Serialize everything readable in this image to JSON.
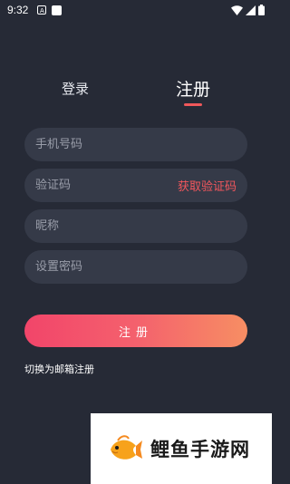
{
  "status_bar": {
    "time": "9:32",
    "notification_icon": "A"
  },
  "tabs": {
    "login_label": "登录",
    "register_label": "注册",
    "active": "register"
  },
  "form": {
    "phone_placeholder": "手机号码",
    "code_placeholder": "验证码",
    "get_code_label": "获取验证码",
    "nickname_placeholder": "昵称",
    "password_placeholder": "设置密码",
    "submit_label": "注册",
    "switch_label": "切换为邮箱注册"
  },
  "watermark": {
    "text": "鲤鱼手游网"
  },
  "colors": {
    "background": "#262a36",
    "field_background": "#353a48",
    "accent": "#f2575d",
    "button_gradient_start": "#f2456a",
    "button_gradient_end": "#f78e63"
  }
}
